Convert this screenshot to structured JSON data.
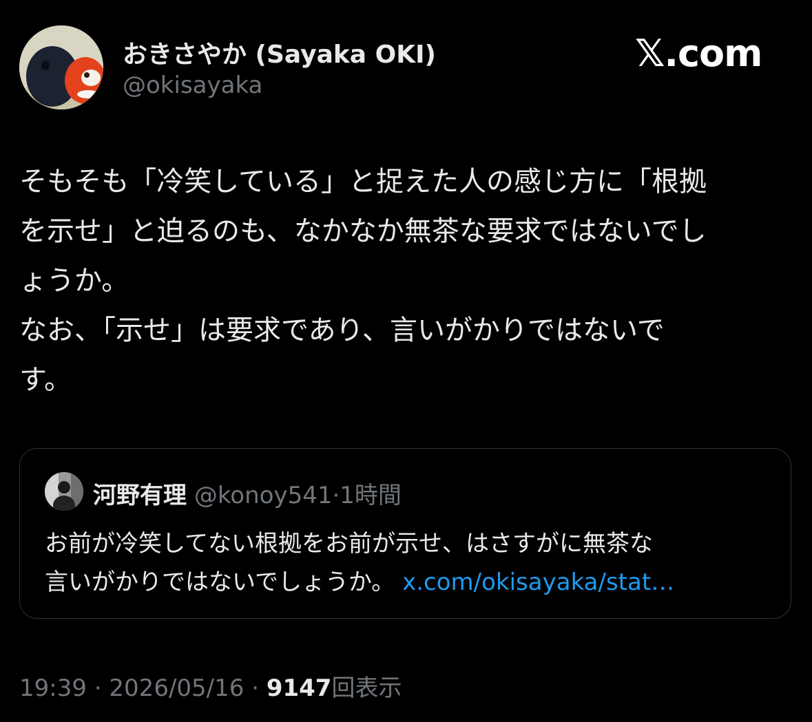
{
  "author": {
    "display_name": "おきさやか (Sayaka OKI)",
    "handle": "@okisayaka",
    "avatar": "avatar-photo"
  },
  "brand": {
    "logo_text": "𝕏.com"
  },
  "tweet": {
    "lines": [
      "そもそも「冷笑している」と捉えた人の感じ方に「根拠",
      "を示せ」と迫るのも、なかなか無茶な要求ではないでし",
      "ょうか。",
      "なお、「示せ」は要求であり、言いがかりではないで",
      "す。"
    ]
  },
  "quote": {
    "name": "河野有理",
    "handle": "@konoy541",
    "separator": "·",
    "time": "1時間",
    "line1": "お前が冷笑してない根拠をお前が示せ、はさすがに無茶な",
    "line2": "言いがかりではないでしょうか。",
    "link": "x.com/okisayaka/stat…"
  },
  "meta": {
    "time": "19:39",
    "sep1": "·",
    "date": "2026/05/16",
    "sep2": "·",
    "views_count": "9147",
    "views_label": "回表示"
  },
  "colors": {
    "background": "#000000",
    "text": "#e7e9ea",
    "muted": "#71767b",
    "link": "#1d9bf0",
    "border": "#2f3336"
  }
}
